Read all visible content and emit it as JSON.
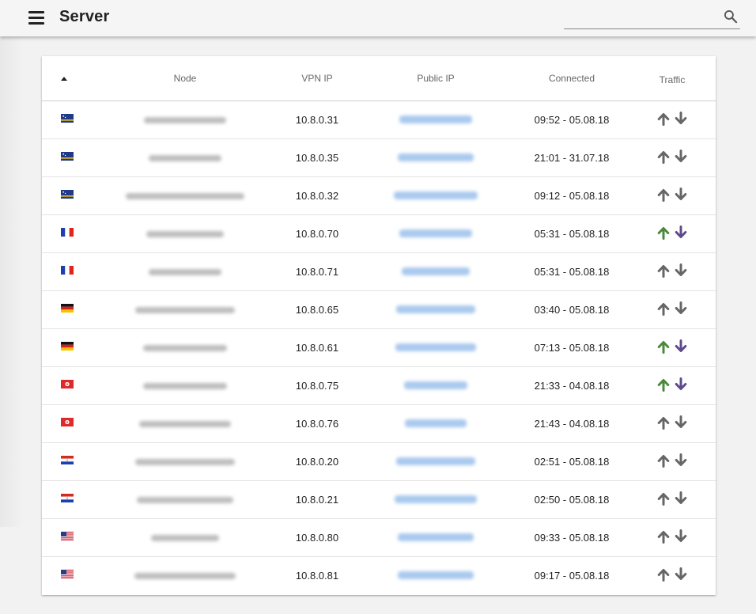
{
  "header": {
    "title": "Server",
    "search_placeholder": "",
    "search_value": ""
  },
  "table": {
    "columns": [
      "",
      "Node",
      "VPN IP",
      "Public IP",
      "Connected",
      "Traffic"
    ],
    "sort": "ascending",
    "rows": [
      {
        "flag": "curacao-flag",
        "node": "",
        "vpn_ip": "10.8.0.31",
        "public_ip": "",
        "connected": "09:52 - 05.08.18",
        "traffic": "idle"
      },
      {
        "flag": "curacao-flag",
        "node": "",
        "vpn_ip": "10.8.0.35",
        "public_ip": "",
        "connected": "21:01 - 31.07.18",
        "traffic": "idle"
      },
      {
        "flag": "curacao-flag",
        "node": "",
        "vpn_ip": "10.8.0.32",
        "public_ip": "",
        "connected": "09:12 - 05.08.18",
        "traffic": "idle"
      },
      {
        "flag": "france-flag",
        "node": "",
        "vpn_ip": "10.8.0.70",
        "public_ip": "",
        "connected": "05:31 - 05.08.18",
        "traffic": "active"
      },
      {
        "flag": "france-flag",
        "node": "",
        "vpn_ip": "10.8.0.71",
        "public_ip": "",
        "connected": "05:31 - 05.08.18",
        "traffic": "idle"
      },
      {
        "flag": "germany-flag",
        "node": "",
        "vpn_ip": "10.8.0.65",
        "public_ip": "",
        "connected": "03:40 - 05.08.18",
        "traffic": "idle"
      },
      {
        "flag": "germany-flag",
        "node": "",
        "vpn_ip": "10.8.0.61",
        "public_ip": "",
        "connected": "07:13 - 05.08.18",
        "traffic": "active"
      },
      {
        "flag": "hong-kong-flag",
        "node": "",
        "vpn_ip": "10.8.0.75",
        "public_ip": "",
        "connected": "21:33 - 04.08.18",
        "traffic": "active"
      },
      {
        "flag": "hong-kong-flag",
        "node": "",
        "vpn_ip": "10.8.0.76",
        "public_ip": "",
        "connected": "21:43 - 04.08.18",
        "traffic": "idle"
      },
      {
        "flag": "paraguay-flag",
        "node": "",
        "vpn_ip": "10.8.0.20",
        "public_ip": "",
        "connected": "02:51 - 05.08.18",
        "traffic": "idle"
      },
      {
        "flag": "paraguay-flag",
        "node": "",
        "vpn_ip": "10.8.0.21",
        "public_ip": "",
        "connected": "02:50 - 05.08.18",
        "traffic": "idle"
      },
      {
        "flag": "usa-flag",
        "node": "",
        "vpn_ip": "10.8.0.80",
        "public_ip": "",
        "connected": "09:33 - 05.08.18",
        "traffic": "idle"
      },
      {
        "flag": "usa-flag",
        "node": "",
        "vpn_ip": "10.8.0.81",
        "public_ip": "",
        "connected": "09:17 - 05.08.18",
        "traffic": "idle"
      }
    ]
  },
  "colors": {
    "upload_active": "#4a8a3c",
    "download_active": "#5e4a8c",
    "idle_arrow": "#666666",
    "redaction_blue": "#a9c9ee",
    "redaction_gray": "#b7b7b7"
  }
}
